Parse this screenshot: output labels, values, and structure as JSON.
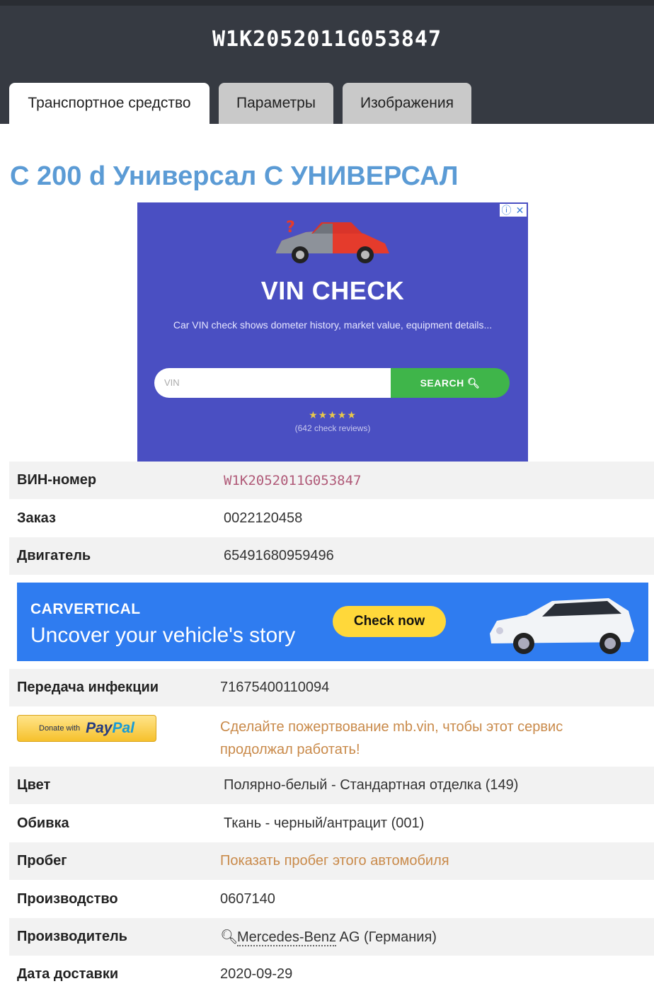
{
  "header": {
    "vin": "W1K2052011G053847",
    "tabs": [
      {
        "label": "Транспортное средство",
        "active": true
      },
      {
        "label": "Параметры",
        "active": false
      },
      {
        "label": "Изображения",
        "active": false
      }
    ]
  },
  "model_title": "C 200 d Универсал C УНИВЕРСАЛ",
  "ad_top": {
    "headline": "VIN CHECK",
    "description": "Car VIN check shows dometer history, market value, equipment details...",
    "input_placeholder": "VIN",
    "button_label": "SEARCH",
    "stars": "★★★★★",
    "reviews": "(642 check reviews)",
    "adchoices_icon": "info-icon",
    "close_icon": "close-icon"
  },
  "rows": {
    "vin": {
      "label": "ВИН-номер",
      "value": "W1K2052011G053847"
    },
    "order": {
      "label": "Заказ",
      "value": "0022120458"
    },
    "engine": {
      "label": "Двигатель",
      "value": "65491680959496"
    },
    "transmission": {
      "label": "Передача инфекции",
      "value": "71675400110094"
    },
    "color": {
      "label": "Цвет",
      "value": "Полярно-белый - Стандартная отделка (149)"
    },
    "upholstery": {
      "label": "Обивка",
      "value": "Ткань - черный/антрацит (001)"
    },
    "mileage": {
      "label": "Пробег",
      "value": "Показать пробег этого автомобиля"
    },
    "production": {
      "label": "Производство",
      "value": "0607140"
    },
    "manufacturer": {
      "label": "Производитель",
      "value_link": "Mercedes-Benz",
      "value_rest": " AG (Германия)"
    },
    "delivery": {
      "label": "Дата доставки",
      "value": "2020-09-29"
    }
  },
  "ad_banner": {
    "brand": "CARVERTICAL",
    "slogan": "Uncover your vehicle's story",
    "cta": "Check now"
  },
  "donate": {
    "button_small": "Donate with",
    "button_pay": "Pay",
    "button_pal": "Pal",
    "text": "Сделайте пожертвование mb.vin, чтобы этот сервис продолжал работать!"
  },
  "colors": {
    "header_bg": "#363a42",
    "title_blue": "#5b9bd5",
    "link_orange": "#c98a4a",
    "vin_pink": "#b05a78",
    "ad_blue": "#2f7cf0",
    "ad_purple": "#4a4fc2"
  }
}
